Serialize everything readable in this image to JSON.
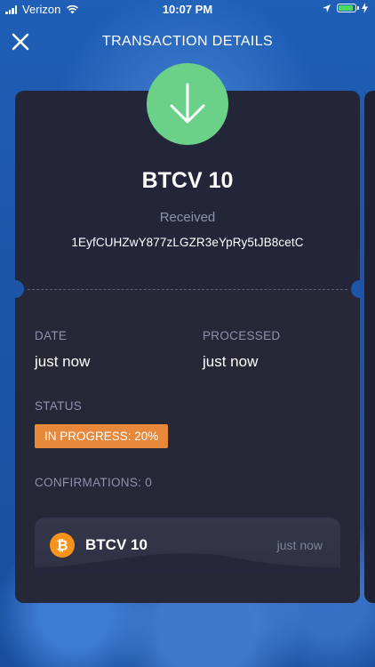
{
  "status_bar": {
    "carrier": "Verizon",
    "time": "10:07 PM",
    "battery_color": "#4cd964"
  },
  "header": {
    "close_icon": "close-icon",
    "title": "TRANSACTION DETAILS"
  },
  "transaction": {
    "icon": "arrow-down-icon",
    "icon_color": "#6bd088",
    "amount": "BTCV 10",
    "direction": "Received",
    "address": "1EyfCUHZwY877zLGZR3eYpRy5tJB8cetC",
    "date_label": "DATE",
    "date_value": "just now",
    "processed_label": "PROCESSED",
    "processed_value": "just now",
    "status_label": "STATUS",
    "status_badge": "IN PROGRESS: 20%",
    "status_color": "#e8883a",
    "confirmations": "CONFIRMATIONS: 0"
  },
  "tx_item": {
    "coin_icon": "bitcoin-icon",
    "name": "BTCV 10",
    "time": "just now"
  }
}
